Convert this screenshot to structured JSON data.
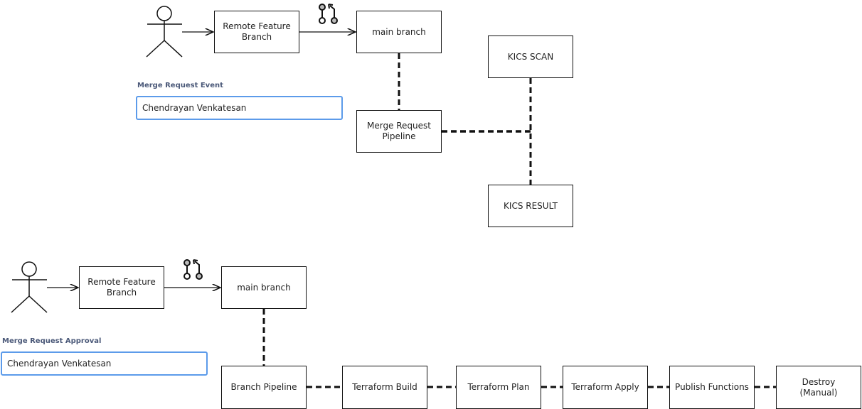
{
  "top_flow": {
    "actor": "user",
    "feature_branch": "Remote Feature\nBranch",
    "main_branch": "main branch",
    "pipeline": "Merge  Request\nPipeline",
    "scan": "KICS SCAN",
    "result": "KICS RESULT",
    "form_label": "Merge Request Event",
    "form_value": "Chendrayan Venkatesan",
    "merge_icon": "git-merge-request-icon"
  },
  "bottom_flow": {
    "actor": "user",
    "feature_branch": "Remote Feature\nBranch",
    "main_branch": "main branch",
    "form_label": "Merge Request Approval",
    "form_value": "Chendrayan Venkatesan",
    "merge_icon": "git-merge-request-icon",
    "stages": [
      "Branch Pipeline",
      "Terraform Build",
      "Terraform Plan",
      "Terraform Apply",
      "Publish Functions",
      "Destroy\n(Manual)"
    ]
  }
}
